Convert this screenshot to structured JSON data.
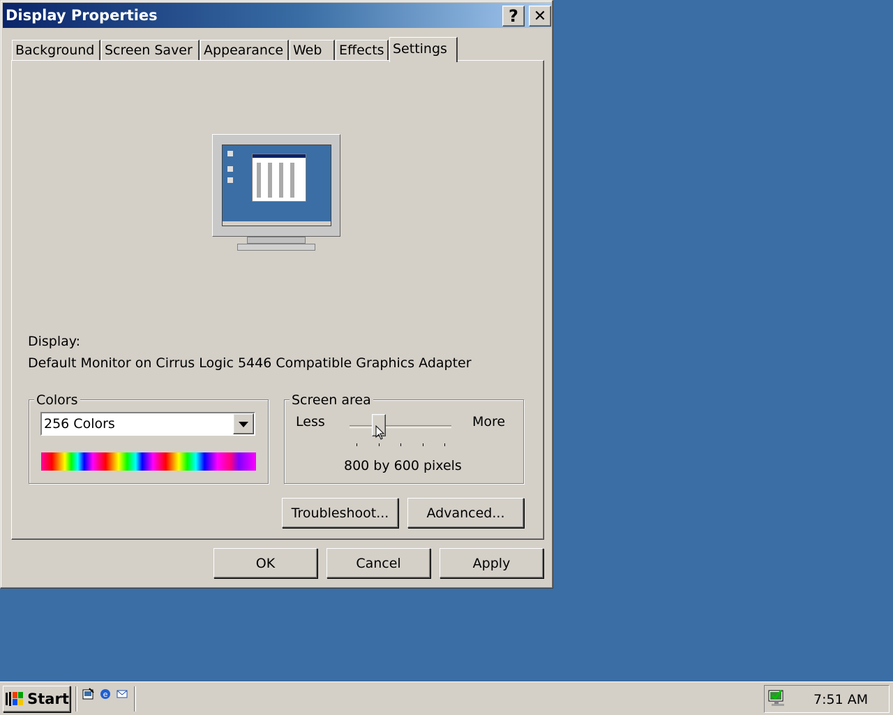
{
  "window": {
    "title": "Display Properties",
    "help_button": "?",
    "close_button": "✕"
  },
  "tabs": [
    {
      "label": "Background"
    },
    {
      "label": "Screen Saver"
    },
    {
      "label": "Appearance"
    },
    {
      "label": "Web"
    },
    {
      "label": "Effects"
    },
    {
      "label": "Settings",
      "active": true
    }
  ],
  "settings": {
    "display_label": "Display:",
    "display_value": "Default Monitor on Cirrus Logic 5446 Compatible Graphics Adapter",
    "colors": {
      "group_label": "Colors",
      "selected": "256 Colors"
    },
    "screen_area": {
      "group_label": "Screen area",
      "less_label": "Less",
      "more_label": "More",
      "resolution": "800 by 600 pixels",
      "slider_position": 1,
      "slider_steps": 5
    },
    "troubleshoot_label": "Troubleshoot...",
    "advanced_label": "Advanced..."
  },
  "footer": {
    "ok_label": "OK",
    "cancel_label": "Cancel",
    "apply_label": "Apply"
  },
  "taskbar": {
    "start_label": "Start",
    "quick_launch": [
      "show-desktop-icon",
      "internet-explorer-icon",
      "outlook-express-icon"
    ],
    "clock": "7:51 AM"
  },
  "colors": {
    "desktop": "#3a6ea5",
    "face": "#d4d0c8",
    "title_active": "#0a246a"
  }
}
